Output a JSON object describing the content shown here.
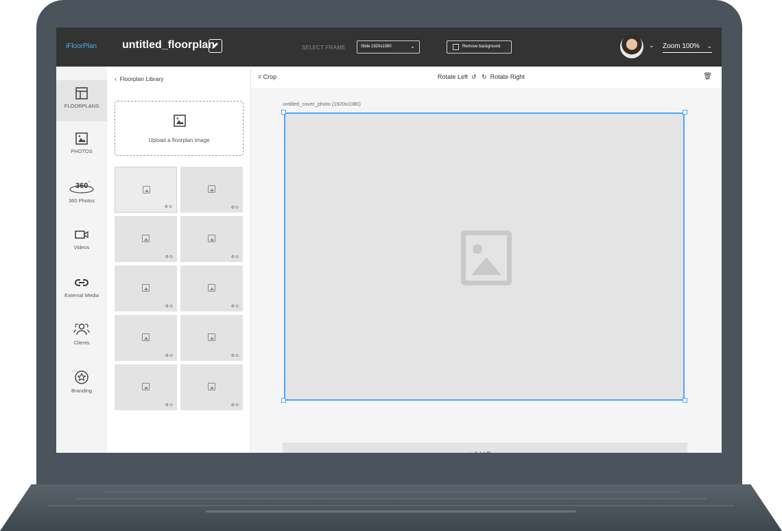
{
  "app": {
    "brand": "iFloorPlan",
    "document_title": "untitled_floorplan"
  },
  "topbar": {
    "select_frame_label": "SELECT FRAME",
    "frame_select_value": "Slide 1920x1080",
    "remove_background_label": "Remove background",
    "zoom_label": "Zoom 100%"
  },
  "sidebar": {
    "items": [
      {
        "label": "FLOORPLANS",
        "icon": "layout-icon",
        "active": true
      },
      {
        "label": "PHOTOS",
        "icon": "image-icon",
        "active": false
      },
      {
        "label": "360 Photos",
        "icon": "360-icon",
        "active": false
      },
      {
        "label": "Videos",
        "icon": "video-icon",
        "active": false
      },
      {
        "label": "External Media",
        "icon": "link-icon",
        "active": false
      },
      {
        "label": "Clients",
        "icon": "users-icon",
        "active": false
      },
      {
        "label": "Branding",
        "icon": "star-badge-icon",
        "active": false
      }
    ]
  },
  "library": {
    "back_label": "Floorplan Library",
    "upload_label": "Upload a floorplan image",
    "thumbnail_count": 10
  },
  "toolbar": {
    "crop_label": "Crop",
    "rotate_left_label": "Rotate Left",
    "rotate_right_label": "Rotate Right"
  },
  "canvas": {
    "frame_caption": "untitled_cover_photo (1920x1080)",
    "add_page_label": "+  Add Page"
  },
  "colors": {
    "accent": "#4da3ff",
    "brand": "#4fb3ea",
    "topbar": "#333333"
  }
}
